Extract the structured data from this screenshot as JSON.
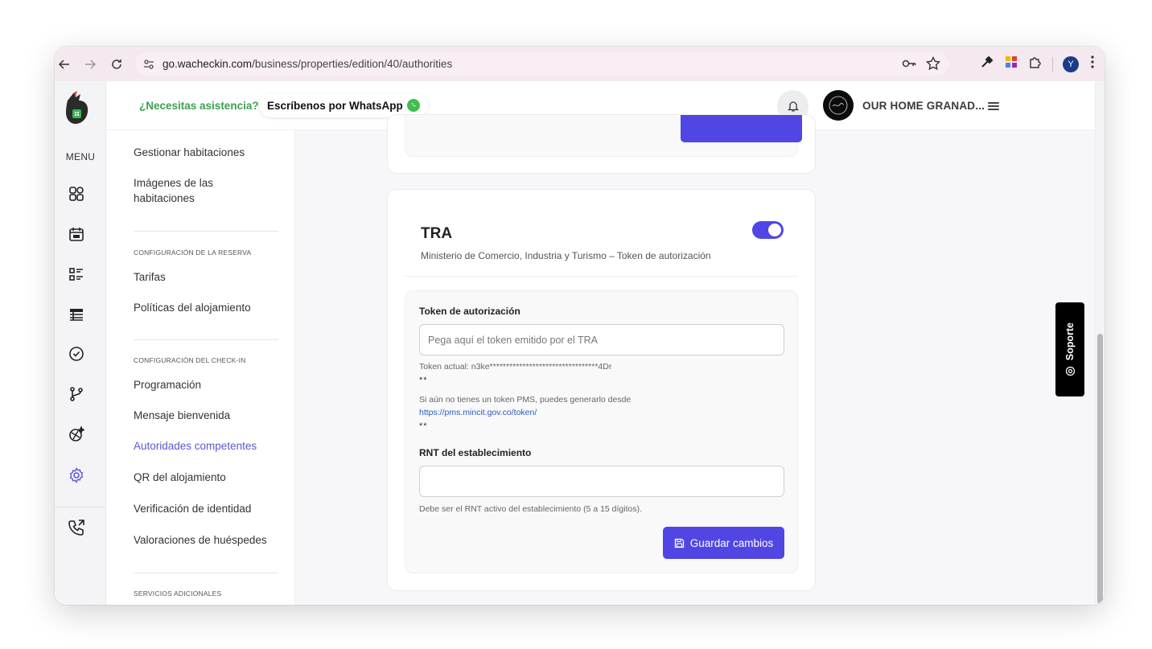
{
  "browser": {
    "url_host": "go.wacheckin.com",
    "url_path": "/business/properties/edition/40/authorities",
    "profile_initial": "Y"
  },
  "rail": {
    "menu_label": "MENU",
    "icons": [
      "dashboard-icon",
      "calendar-icon",
      "list-icon",
      "table-icon",
      "check-circle-icon",
      "git-branch-icon",
      "sparkle-lens-icon",
      "settings-icon",
      "phone-icon"
    ]
  },
  "topbar": {
    "help_question": "¿Necesitas asistencia?",
    "whatsapp_label": "Escríbenos por WhatsApp",
    "property_name": "OUR HOME GRANAD..."
  },
  "submenu": {
    "items_rooms": [
      "Gestionar habitaciones",
      "Imágenes de las habitaciones"
    ],
    "section_booking": "CONFIGURACIÓN DE LA RESERVA",
    "items_booking": [
      "Tarifas",
      "Políticas del alojamiento"
    ],
    "section_checkin": "CONFIGURACIÓN DEL CHECK-IN",
    "items_checkin": [
      "Programación",
      "Mensaje bienvenida",
      "Autoridades competentes",
      "QR del alojamiento",
      "Verificación de identidad",
      "Valoraciones de huéspedes"
    ],
    "section_extra": "SERVICIOS ADICIONALES"
  },
  "card": {
    "title": "TRA",
    "subtitle": "Ministerio de Comercio, Industria y Turismo – Token de autorización",
    "toggle_on": true,
    "token_label": "Token de autorización",
    "token_placeholder": "Pega aquí el token emitido por el TRA",
    "token_current": "Token actual: n3ke*********************************4Dr",
    "stars_1": "**",
    "pms_help": "Si aún no tienes un token PMS, puedes generarlo desde",
    "pms_link": "https://pms.mincit.gov.co/token/",
    "stars_2": "**",
    "rnt_label": "RNT del establecimiento",
    "rnt_value": "",
    "rnt_help": "Debe ser el RNT activo del establecimiento (5 a 15 dígitos).",
    "save_label": "Guardar cambios"
  },
  "support": {
    "label": "Soporte"
  },
  "colors": {
    "accent": "#5146e3",
    "whatsapp_green": "#3fbf4f",
    "help_green": "#3aa150",
    "active_link": "#5b57d9"
  }
}
